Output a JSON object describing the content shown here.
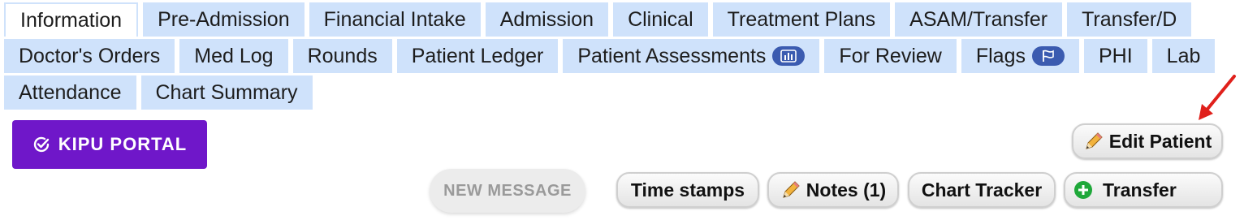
{
  "tabs": {
    "row1": [
      "Information",
      "Pre-Admission",
      "Financial Intake",
      "Admission",
      "Clinical",
      "Treatment Plans",
      "ASAM/Transfer",
      "Transfer/D"
    ],
    "row2": [
      "Doctor's Orders",
      "Med Log",
      "Rounds",
      "Patient Ledger",
      "Patient Assessments",
      "For Review",
      "Flags",
      "PHI",
      "Lab"
    ],
    "row3": [
      "Attendance",
      "Chart Summary"
    ],
    "active": "Information"
  },
  "buttons": {
    "kipu_portal": "KIPU PORTAL",
    "edit_patient": "Edit Patient",
    "new_message": "NEW MESSAGE",
    "time_stamps": "Time stamps",
    "notes": "Notes (1)",
    "chart_tracker": "Chart Tracker",
    "transfer": "Transfer"
  },
  "colors": {
    "tab_bg": "#cfe2fb",
    "portal_purple": "#6f17c9",
    "badge_blue": "#3b5bb0",
    "arrow_red": "#e0201b",
    "transfer_green": "#1fa83a"
  },
  "icons": {
    "patient_assessments": "bar-chart-icon",
    "flags": "flag-icon",
    "kipu_portal": "check-circle-icon",
    "edit_patient": "pencil-icon",
    "notes": "pencil-icon",
    "transfer": "plus-circle-icon"
  }
}
